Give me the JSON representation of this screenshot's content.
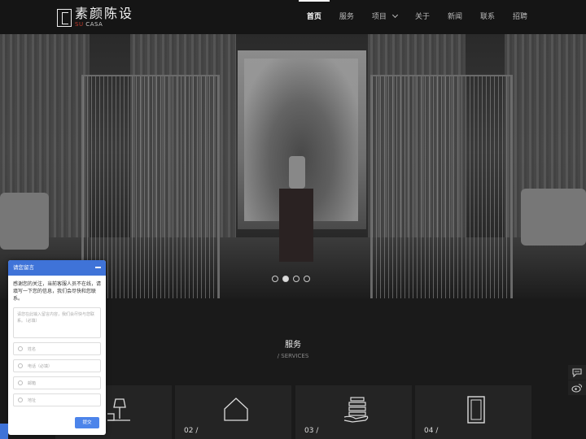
{
  "header": {
    "logo_cn": "素颜陈设",
    "logo_en_prefix": "SU",
    "logo_en_suffix": " CASA",
    "nav": [
      {
        "label": "首页",
        "active": true
      },
      {
        "label": "服务"
      },
      {
        "label": "项目",
        "dropdown": true
      },
      {
        "label": "关于"
      },
      {
        "label": "新闻"
      },
      {
        "label": "联系"
      },
      {
        "label": "招聘"
      }
    ]
  },
  "carousel": {
    "slide_count": 4,
    "active_index": 1
  },
  "services": {
    "title": "服务",
    "subtitle": "/ SERVICES",
    "cards": [
      {
        "num": "",
        "icon": "lamp-icon"
      },
      {
        "num": "02 /",
        "icon": "house-icon"
      },
      {
        "num": "03 /",
        "icon": "stack-hand-icon"
      },
      {
        "num": "04 /",
        "icon": "frame-icon"
      }
    ]
  },
  "chat": {
    "title": "请您留言",
    "message": "感谢您的关注，当前客服人员不在线，请填写一下您的信息，我们会尽快和您联系。",
    "textarea_placeholder": "请您在此输入留言内容，我们会尽快与您联系。（必填）",
    "name_placeholder": "姓名",
    "phone_placeholder": "电话（必填）",
    "email_placeholder": "邮箱",
    "address_placeholder": "地址",
    "submit": "提交"
  },
  "colors": {
    "accent": "#3f73d8",
    "background": "#1a1a1a"
  }
}
